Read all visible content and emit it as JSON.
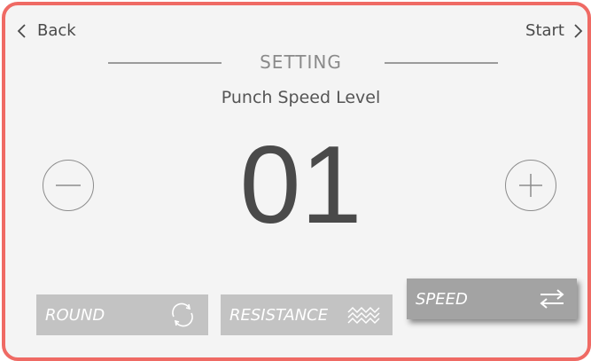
{
  "nav": {
    "back_label": "Back",
    "start_label": "Start"
  },
  "header": {
    "section_title": "SETTING",
    "subtitle": "Punch Speed Level"
  },
  "level": {
    "value": "01"
  },
  "modes": [
    {
      "label": "ROUND",
      "icon": "refresh-icon",
      "selected": false
    },
    {
      "label": "RESISTANCE",
      "icon": "wave-icon",
      "selected": false
    },
    {
      "label": "SPEED",
      "icon": "swap-arrows-icon",
      "selected": true
    }
  ],
  "colors": {
    "frame_border": "#ef6a64",
    "background": "#f4f4f4",
    "mode_button": "#c3c3c3",
    "mode_button_selected": "#a3a3a3",
    "text_dark": "#4a4a4a"
  }
}
